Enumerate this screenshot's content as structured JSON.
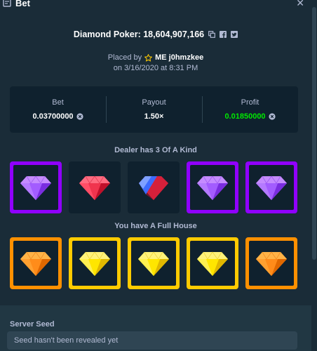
{
  "window": {
    "title": "Bet"
  },
  "header": {
    "game_title": "Diamond Poker: 18,604,907,166"
  },
  "placed": {
    "prefix": "Placed by",
    "username": "ME j0hmzkee",
    "date": "on 3/16/2020 at 8:31 PM"
  },
  "stats": {
    "bet_label": "Bet",
    "bet_value": "0.03700000",
    "payout_label": "Payout",
    "payout_value": "1.50×",
    "profit_label": "Profit",
    "profit_value": "0.01850000"
  },
  "dealer": {
    "label": "Dealer has 3 Of A Kind",
    "cards": [
      {
        "gem": "purple-gem",
        "highlight": "purple"
      },
      {
        "gem": "red-gem",
        "highlight": "none"
      },
      {
        "gem": "blue-red-gem",
        "highlight": "none"
      },
      {
        "gem": "purple-gem",
        "highlight": "purple"
      },
      {
        "gem": "purple-gem",
        "highlight": "purple"
      }
    ]
  },
  "player": {
    "label": "You have A Full House",
    "cards": [
      {
        "gem": "orange-gem",
        "highlight": "orange"
      },
      {
        "gem": "yellow-gem",
        "highlight": "yellow"
      },
      {
        "gem": "yellow-gem",
        "highlight": "yellow"
      },
      {
        "gem": "yellow-gem",
        "highlight": "yellow"
      },
      {
        "gem": "orange-gem",
        "highlight": "orange"
      }
    ]
  },
  "server_seed": {
    "label": "Server Seed",
    "value": "Seed hasn't been revealed yet"
  },
  "colors": {
    "background": "#1a2c38",
    "panel": "#0f212e",
    "profit_green": "#00e701",
    "purple": "#9000ff",
    "orange": "#ff9000",
    "yellow": "#ffcb00"
  }
}
